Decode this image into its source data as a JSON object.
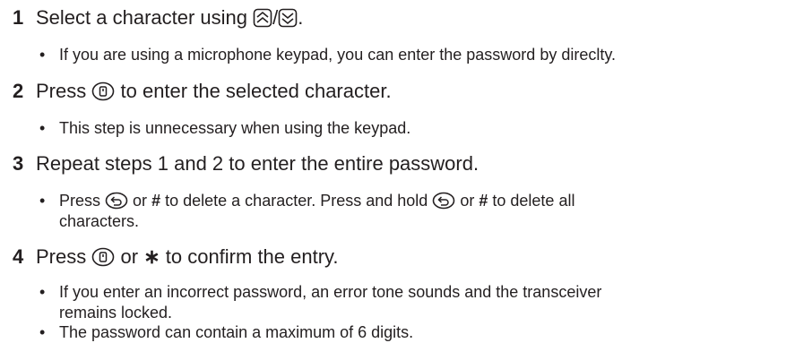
{
  "steps": [
    {
      "number": "1",
      "text_before": "Select a character using",
      "separator": "/",
      "text_after": ".",
      "icons": [
        "up-key-icon",
        "down-key-icon"
      ],
      "notes": [
        {
          "bullet": "•",
          "text": "If you are using a microphone keypad, you can enter the password by direclty."
        }
      ]
    },
    {
      "number": "2",
      "text_before": "Press",
      "text_after": "to enter the selected character.",
      "icons": [
        "dial-button-icon"
      ],
      "notes": [
        {
          "bullet": "•",
          "text": "This step is unnecessary when using the keypad."
        }
      ]
    },
    {
      "number": "3",
      "text": "Repeat steps 1 and 2 to enter the entire password.",
      "notes": [
        {
          "bullet": "•",
          "t1": "Press",
          "t2": "or",
          "k1": "#",
          "t3": "to delete a character.  Press and hold",
          "t4": "or",
          "k2": "#",
          "t5": "to delete all",
          "t6": "characters.",
          "icons": [
            "back-button-icon"
          ]
        }
      ]
    },
    {
      "number": "4",
      "text_before": "Press",
      "mid": "or",
      "key": "∗",
      "text_after": "to confirm the entry.",
      "icons": [
        "dial-button-icon"
      ],
      "notes": [
        {
          "bullet": "•",
          "line1": "If you enter an incorrect password, an error tone sounds and the transceiver",
          "line2": "remains locked."
        },
        {
          "bullet": "•",
          "text": "The password can contain a maximum of 6 digits."
        }
      ]
    }
  ]
}
